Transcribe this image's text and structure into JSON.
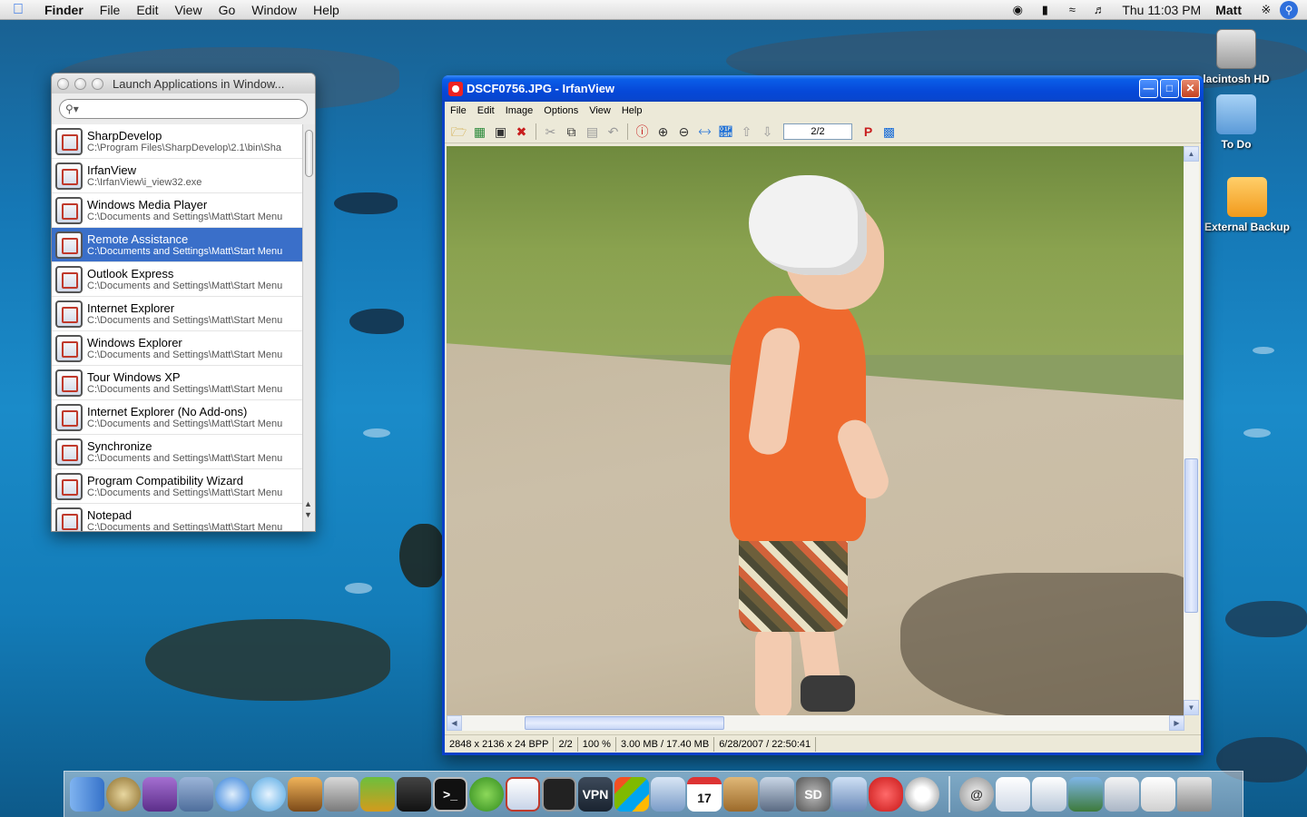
{
  "menubar": {
    "app": "Finder",
    "items": [
      "File",
      "Edit",
      "View",
      "Go",
      "Window",
      "Help"
    ],
    "clock": "Thu 11:03 PM",
    "user": "Matt"
  },
  "desktop": {
    "icons": [
      {
        "label": "Macintosh HD",
        "shown_label": "lacintosh HD"
      },
      {
        "label": "To Do"
      },
      {
        "label": "External Backup"
      }
    ]
  },
  "launch_window": {
    "title": "Launch Applications in Window...",
    "search_placeholder": "",
    "items": [
      {
        "name": "SharpDevelop",
        "path": "C:\\Program Files\\SharpDevelop\\2.1\\bin\\Sha"
      },
      {
        "name": "IrfanView",
        "path": "C:\\IrfanView\\i_view32.exe"
      },
      {
        "name": "Windows Media Player",
        "path": "C:\\Documents and Settings\\Matt\\Start Menu"
      },
      {
        "name": "Remote Assistance",
        "path": "C:\\Documents and Settings\\Matt\\Start Menu",
        "selected": true
      },
      {
        "name": "Outlook Express",
        "path": "C:\\Documents and Settings\\Matt\\Start Menu"
      },
      {
        "name": "Internet Explorer",
        "path": "C:\\Documents and Settings\\Matt\\Start Menu"
      },
      {
        "name": "Windows Explorer",
        "path": "C:\\Documents and Settings\\Matt\\Start Menu"
      },
      {
        "name": "Tour Windows XP",
        "path": "C:\\Documents and Settings\\Matt\\Start Menu"
      },
      {
        "name": "Internet Explorer (No Add-ons)",
        "path": "C:\\Documents and Settings\\Matt\\Start Menu"
      },
      {
        "name": "Synchronize",
        "path": "C:\\Documents and Settings\\Matt\\Start Menu"
      },
      {
        "name": "Program Compatibility Wizard",
        "path": "C:\\Documents and Settings\\Matt\\Start Menu"
      },
      {
        "name": "Notepad",
        "path": "C:\\Documents and Settings\\Matt\\Start Menu"
      }
    ]
  },
  "irfanview": {
    "title": "DSCF0756.JPG - IrfanView",
    "menu": [
      "File",
      "Edit",
      "Image",
      "Options",
      "View",
      "Help"
    ],
    "page": "2/2",
    "status": {
      "dimensions": "2848 x 2136 x 24 BPP",
      "page": "2/2",
      "zoom": "100 %",
      "size": "3.00 MB / 17.40 MB",
      "date": "6/28/2007 / 22:50:41"
    }
  },
  "dock": {
    "labels": {
      "vpn": "VPN",
      "calendar_day": "17",
      "sd": "SD"
    }
  }
}
